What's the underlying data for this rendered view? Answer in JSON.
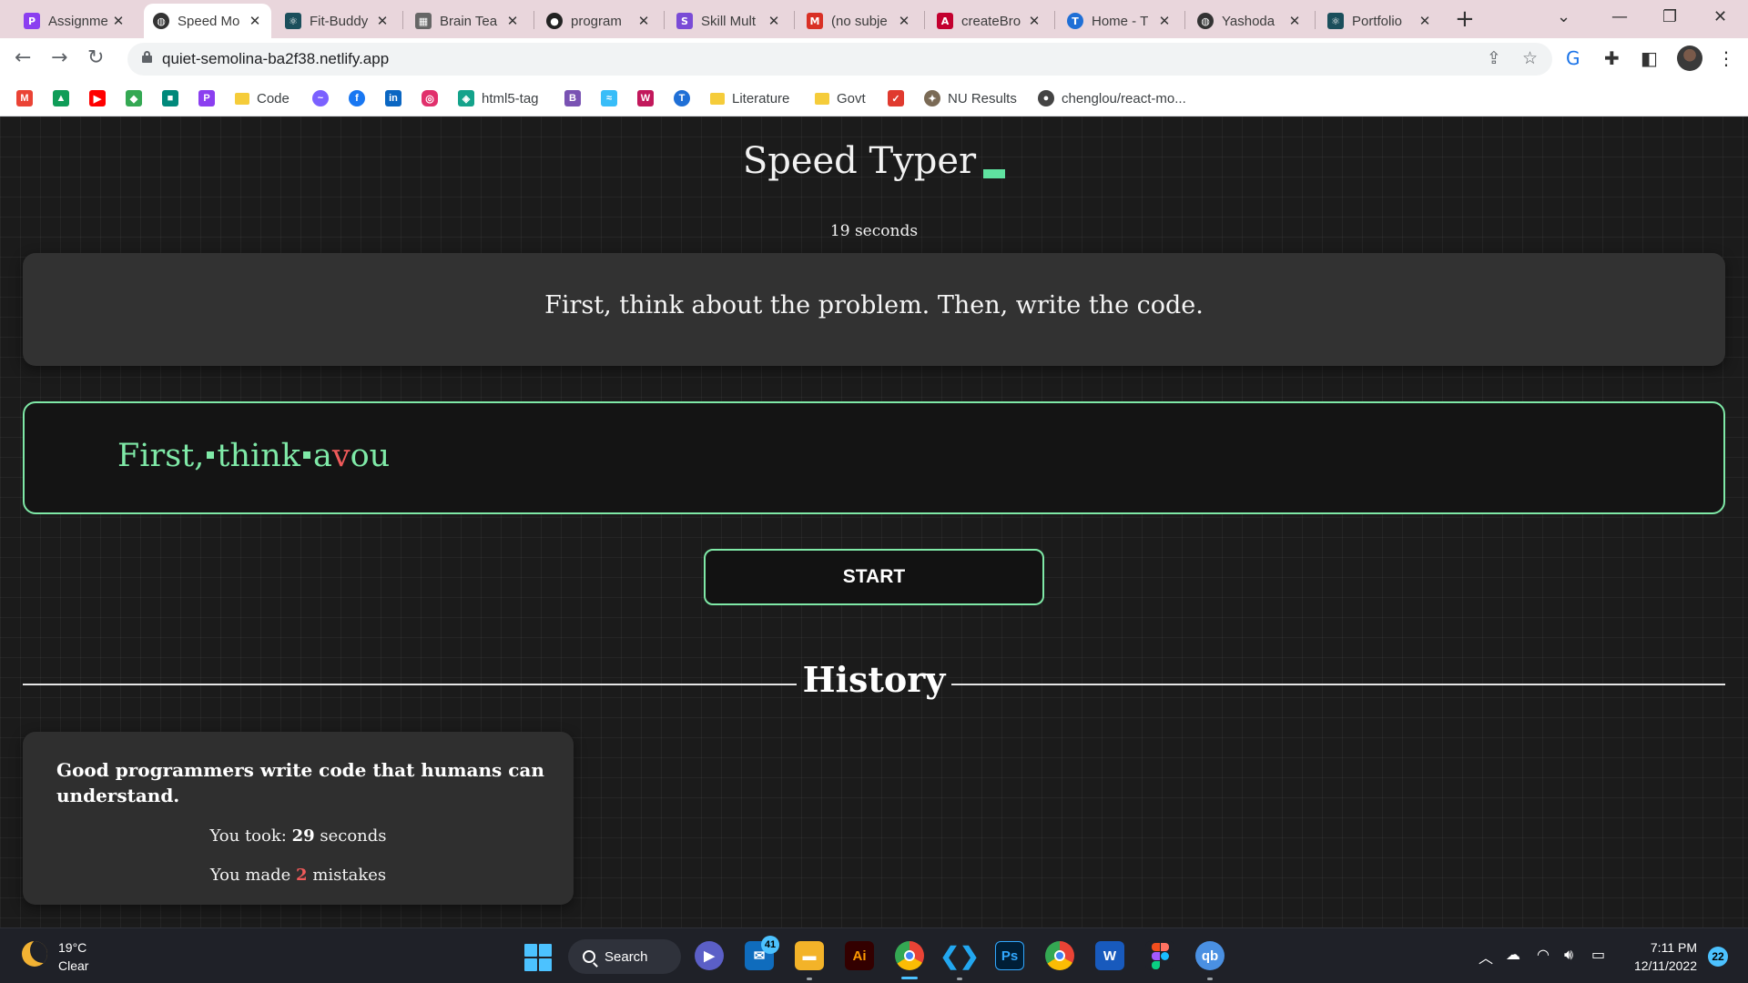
{
  "browser": {
    "tabs": [
      {
        "label": "Assignme",
        "icon": "p-app-icon",
        "color": "#8b3ff0"
      },
      {
        "label": "Speed Mo",
        "icon": "globe-icon",
        "color": "#444444"
      },
      {
        "label": "Fit-Buddy",
        "icon": "react-icon",
        "color": "#1b4f5c"
      },
      {
        "label": "Brain Tea",
        "icon": "grid-icon",
        "color": "#555555"
      },
      {
        "label": "program",
        "icon": "github-icon",
        "color": "#222222"
      },
      {
        "label": "Skill Mult",
        "icon": "skill-icon",
        "color": "#7a4bd6"
      },
      {
        "label": "(no subje",
        "icon": "gmail-icon",
        "color": "#d93025"
      },
      {
        "label": "createBro",
        "icon": "angular-icon",
        "color": "#c3002f"
      },
      {
        "label": "Home - T",
        "icon": "t-icon",
        "color": "#1f6fd6"
      },
      {
        "label": "Yashoda",
        "icon": "globe-icon",
        "color": "#444444"
      },
      {
        "label": "Portfolio",
        "icon": "react-icon",
        "color": "#1b4f5c"
      }
    ],
    "url": "quiet-semolina-ba2f38.netlify.app",
    "bookmarks": {
      "code": "Code",
      "html5tag": "html5-tag",
      "literature": "Literature",
      "govt": "Govt",
      "nu_results": "NU Results",
      "chenglou": "chenglou/react-mo..."
    }
  },
  "app": {
    "title": "Speed Typer",
    "timer": "19 seconds",
    "quote": "First, think about the problem. Then, write the code.",
    "typed": {
      "correct1": "First,",
      "correct2": "think",
      "correct3": "a",
      "wrong": "v",
      "correct4": "ou"
    },
    "start_label": "START",
    "history_title": "History",
    "history": [
      {
        "quote": "Good programmers write code that humans can understand.",
        "took_prefix": "You took:",
        "took_value": "29",
        "took_suffix": "seconds",
        "mistakes_prefix": "You made",
        "mistakes_value": "2",
        "mistakes_suffix": "mistakes"
      }
    ],
    "accent_color": "#7fe9a7",
    "error_color": "#f05a5a"
  },
  "taskbar": {
    "temperature": "19°C",
    "condition": "Clear",
    "search_label": "Search",
    "mail_badge": "41",
    "time": "7:11 PM",
    "date": "12/11/2022",
    "notifications": "22"
  }
}
